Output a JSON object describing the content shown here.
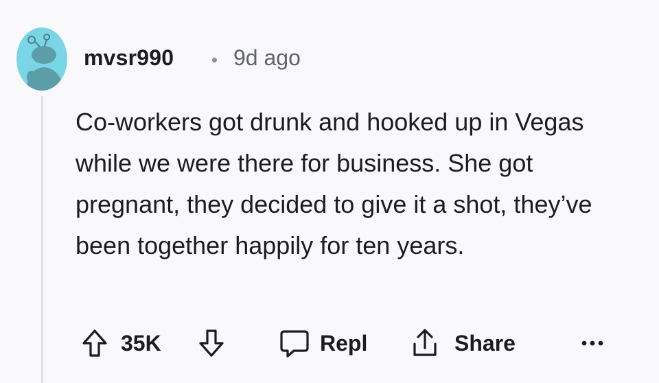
{
  "comment": {
    "username": "mvsr990",
    "separator": "·",
    "timestamp": "9d ago",
    "body": "Co-workers got drunk and hooked up in Vegas while we were there for business. She got pregnant, they decided to give it a shot, they’ve been together happily for ten years."
  },
  "actions": {
    "vote_count": "35K",
    "reply_label": "Repl",
    "share_label": "Share",
    "more_label": "•••"
  },
  "icons": {
    "upvote": "arrow-up-outline-icon",
    "downvote": "arrow-down-outline-icon",
    "reply": "speech-bubble-icon",
    "share": "share-upload-icon",
    "more": "more-dots-icon"
  },
  "colors": {
    "background": "#f9f9fb",
    "avatar": "#7ad6e6",
    "text": "#1c1c1e",
    "muted": "#5f6368",
    "thread_line": "#dcdfe4"
  }
}
